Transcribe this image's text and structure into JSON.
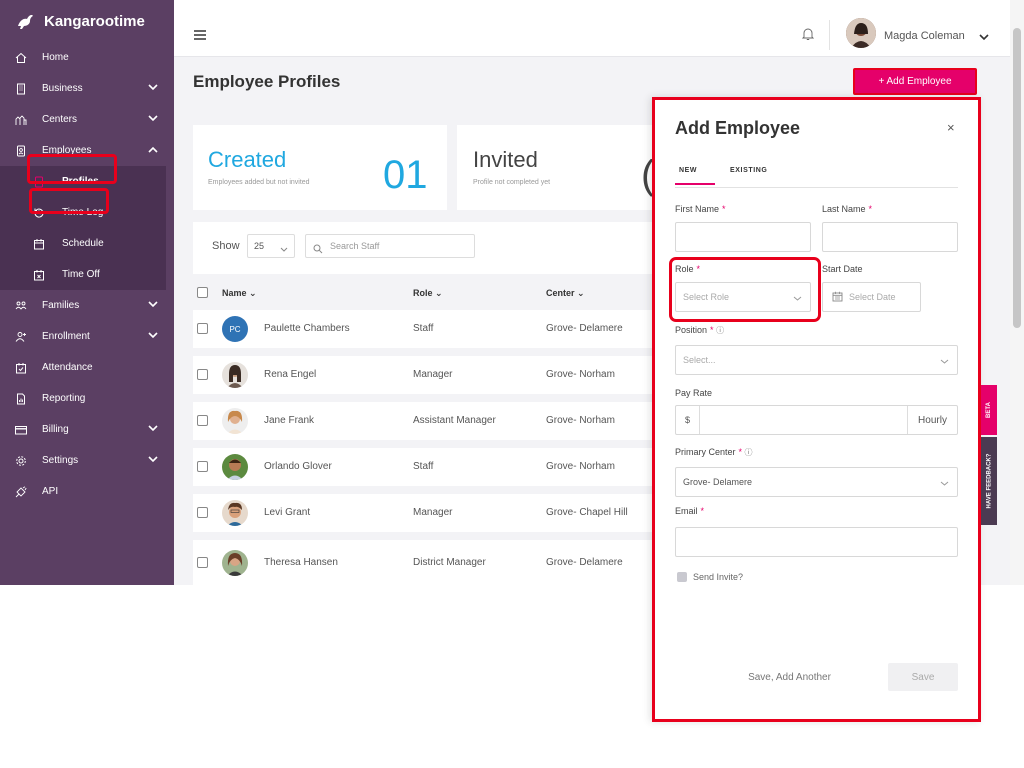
{
  "brand": {
    "name": "Kangarootime"
  },
  "sidebar": {
    "items": [
      {
        "label": "Home",
        "icon": "home-icon"
      },
      {
        "label": "Business",
        "icon": "building-icon",
        "expandable": true
      },
      {
        "label": "Centers",
        "icon": "centers-icon",
        "expandable": true
      },
      {
        "label": "Employees",
        "icon": "employee-badge-icon",
        "expandable": true,
        "expanded": true
      },
      {
        "label": "Families",
        "icon": "families-icon",
        "expandable": true
      },
      {
        "label": "Enrollment",
        "icon": "add-person-icon",
        "expandable": true
      },
      {
        "label": "Attendance",
        "icon": "calendar-check-icon"
      },
      {
        "label": "Reporting",
        "icon": "report-icon"
      },
      {
        "label": "Billing",
        "icon": "card-icon",
        "expandable": true
      },
      {
        "label": "Settings",
        "icon": "gear-icon",
        "expandable": true
      },
      {
        "label": "API",
        "icon": "api-icon"
      }
    ],
    "employee_sub": [
      {
        "label": "Profiles",
        "active": true
      },
      {
        "label": "Time Log"
      },
      {
        "label": "Schedule"
      },
      {
        "label": "Time Off"
      }
    ]
  },
  "topbar": {
    "user_name": "Magda Coleman"
  },
  "page": {
    "title": "Employee Profiles",
    "add_button": "+ Add Employee"
  },
  "stats": {
    "created": {
      "label": "Created",
      "desc": "Employees added but not invited",
      "count": "01"
    },
    "invited": {
      "label": "Invited",
      "desc": "Profile not completed yet",
      "count": "("
    }
  },
  "toolbar": {
    "show_label": "Show",
    "page_size": "25",
    "search_placeholder": "Search Staff"
  },
  "table": {
    "columns": [
      "Name",
      "Role",
      "Center"
    ],
    "rows": [
      {
        "initials": "PC",
        "name": "Paulette Chambers",
        "role": "Staff",
        "center": "Grove- Delamere"
      },
      {
        "initials": "",
        "name": "Rena Engel",
        "role": "Manager",
        "center": "Grove- Norham"
      },
      {
        "initials": "",
        "name": "Jane Frank",
        "role": "Assistant Manager",
        "center": "Grove- Norham"
      },
      {
        "initials": "",
        "name": "Orlando Glover",
        "role": "Staff",
        "center": "Grove- Norham"
      },
      {
        "initials": "",
        "name": "Levi Grant",
        "role": "Manager",
        "center": "Grove- Chapel Hill"
      },
      {
        "initials": "",
        "name": "Theresa Hansen",
        "role": "District Manager",
        "center": "Grove- Delamere"
      }
    ]
  },
  "modal": {
    "title": "Add Employee",
    "close": "×",
    "tabs": [
      "NEW",
      "EXISTING"
    ],
    "fields": {
      "first_name": "First Name",
      "last_name": "Last Name",
      "role": "Role",
      "role_placeholder": "Select Role",
      "start_date": "Start Date",
      "start_date_placeholder": "Select Date",
      "position": "Position",
      "position_placeholder": "Select...",
      "pay_rate": "Pay Rate",
      "pay_currency": "$",
      "pay_unit": "Hourly",
      "primary_center": "Primary Center",
      "primary_center_value": "Grove- Delamere",
      "email": "Email",
      "send_invite": "Send Invite?"
    },
    "save_another": "Save, Add Another",
    "save": "Save"
  },
  "side_tabs": {
    "beta": "BETA",
    "feedback": "HAVE FEEDBACK?"
  },
  "colors": {
    "sidebar": "#5b3f63",
    "accent": "#e5006a",
    "highlight": "#e8001c",
    "stat": "#20a8e0"
  }
}
